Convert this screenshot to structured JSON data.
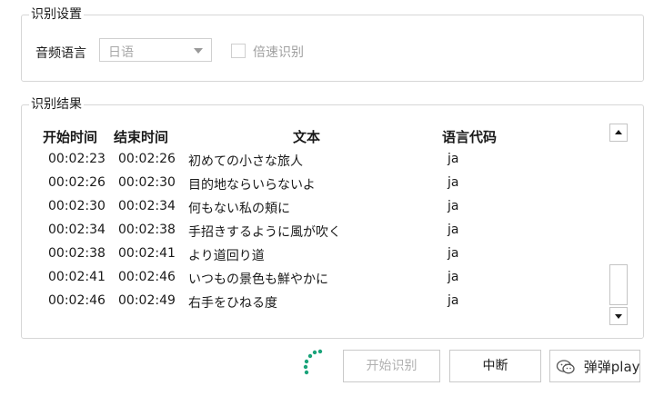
{
  "settings": {
    "title": "识别设置",
    "audio_language_label": "音频语言",
    "audio_language_value": "日语",
    "speed_checkbox_label": "倍速识别",
    "speed_checkbox_checked": false
  },
  "results": {
    "title": "识别结果",
    "columns": [
      "开始时间",
      "结束时间",
      "文本",
      "语言代码"
    ],
    "rows": [
      {
        "start": "00:02:23",
        "end": "00:02:26",
        "text": "初めての小さな旅人",
        "lang": "ja"
      },
      {
        "start": "00:02:26",
        "end": "00:02:30",
        "text": "目的地ならいらないよ",
        "lang": "ja"
      },
      {
        "start": "00:02:30",
        "end": "00:02:34",
        "text": "何もない私の頬に",
        "lang": "ja"
      },
      {
        "start": "00:02:34",
        "end": "00:02:38",
        "text": "手招きするように風が吹く",
        "lang": "ja"
      },
      {
        "start": "00:02:38",
        "end": "00:02:41",
        "text": "より道回り道",
        "lang": "ja"
      },
      {
        "start": "00:02:41",
        "end": "00:02:46",
        "text": "いつもの景色も鮮やかに",
        "lang": "ja"
      },
      {
        "start": "00:02:46",
        "end": "00:02:49",
        "text": "右手をひねる度",
        "lang": "ja"
      }
    ]
  },
  "footer": {
    "start_button": "开始识别",
    "stop_button": "中断",
    "third_button": "",
    "watermark": "弹弹play"
  },
  "icons": {
    "spinner": "loading-spinner-icon",
    "watermark": "wechat-icon",
    "select_arrow": "chevron-down-icon"
  },
  "colors": {
    "spinner": "#1aa37a",
    "border": "#d6d6d6",
    "disabled_text": "#a8a8a8"
  }
}
